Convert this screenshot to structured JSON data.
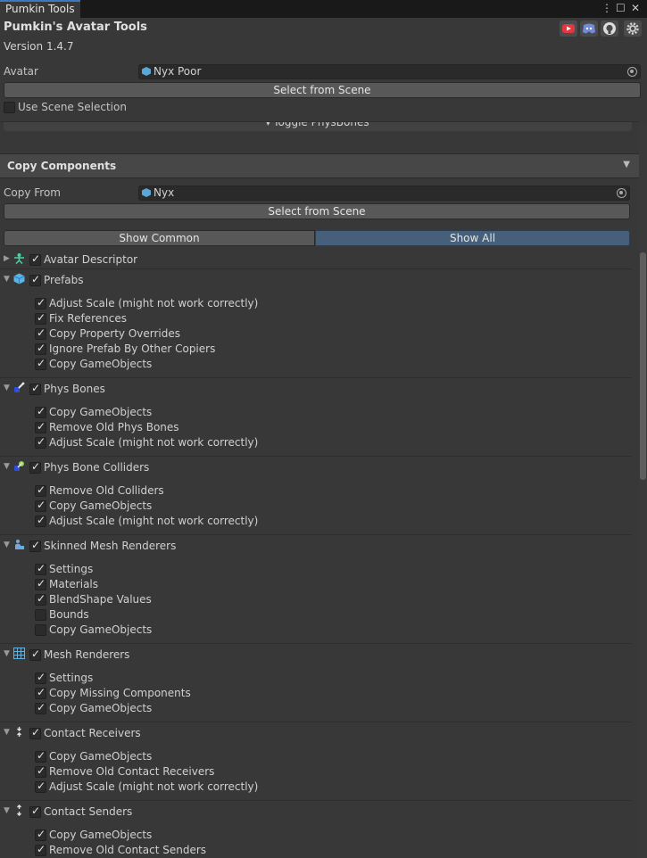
{
  "window": {
    "tab_title": "Pumkin Tools",
    "menu_glyph": "⋮",
    "maximize_glyph": "☐",
    "close_glyph": "✕"
  },
  "header": {
    "title": "Pumkin's Avatar Tools",
    "version": "Version 1.4.7",
    "icons": [
      "youtube-icon",
      "discord-icon",
      "github-icon",
      "settings-icon"
    ]
  },
  "avatar": {
    "label": "Avatar",
    "value": "Nyx Poor",
    "select_button": "Select from Scene",
    "use_scene_selection": {
      "label": "Use Scene Selection",
      "checked": false
    }
  },
  "clipped_toolbar": {
    "label": "Toggle PhysBones"
  },
  "copy_components": {
    "title": "Copy Components",
    "copy_from_label": "Copy From",
    "copy_from_value": "Nyx",
    "select_button": "Select from Scene",
    "filter": {
      "show_common": "Show Common",
      "show_all": "Show All",
      "active": "show_all"
    },
    "components": [
      {
        "name": "Avatar Descriptor",
        "checked": true,
        "expanded": false,
        "icon": "avatar-descriptor-icon",
        "options": []
      },
      {
        "name": "Prefabs",
        "checked": true,
        "expanded": true,
        "icon": "prefab-cube-icon",
        "options": [
          {
            "label": "Adjust Scale (might not work correctly)",
            "checked": true
          },
          {
            "label": "Fix References",
            "checked": true
          },
          {
            "label": "Copy Property Overrides",
            "checked": true
          },
          {
            "label": "Ignore Prefab By Other Copiers",
            "checked": true
          },
          {
            "label": "Copy GameObjects",
            "checked": true
          }
        ]
      },
      {
        "name": "Phys Bones",
        "checked": true,
        "expanded": true,
        "icon": "physbone-icon",
        "options": [
          {
            "label": "Copy GameObjects",
            "checked": true
          },
          {
            "label": "Remove Old Phys Bones",
            "checked": true
          },
          {
            "label": "Adjust Scale (might not work correctly)",
            "checked": true
          }
        ]
      },
      {
        "name": "Phys Bone Colliders",
        "checked": true,
        "expanded": true,
        "icon": "physbone-collider-icon",
        "options": [
          {
            "label": "Remove Old Colliders",
            "checked": true
          },
          {
            "label": "Copy GameObjects",
            "checked": true
          },
          {
            "label": "Adjust Scale (might not work correctly)",
            "checked": true
          }
        ]
      },
      {
        "name": "Skinned Mesh Renderers",
        "checked": true,
        "expanded": true,
        "icon": "skinned-mesh-renderer-icon",
        "options": [
          {
            "label": "Settings",
            "checked": true
          },
          {
            "label": "Materials",
            "checked": true
          },
          {
            "label": "BlendShape Values",
            "checked": true
          },
          {
            "label": "Bounds",
            "checked": false
          },
          {
            "label": "Copy GameObjects",
            "checked": false
          }
        ]
      },
      {
        "name": "Mesh Renderers",
        "checked": true,
        "expanded": true,
        "icon": "mesh-renderer-icon",
        "options": [
          {
            "label": "Settings",
            "checked": true
          },
          {
            "label": "Copy Missing Components",
            "checked": true
          },
          {
            "label": "Copy GameObjects",
            "checked": true
          }
        ]
      },
      {
        "name": "Contact Receivers",
        "checked": true,
        "expanded": true,
        "icon": "contact-receiver-icon",
        "options": [
          {
            "label": "Copy GameObjects",
            "checked": true
          },
          {
            "label": "Remove Old Contact Receivers",
            "checked": true
          },
          {
            "label": "Adjust Scale (might not work correctly)",
            "checked": true
          }
        ]
      },
      {
        "name": "Contact Senders",
        "checked": true,
        "expanded": true,
        "icon": "contact-sender-icon",
        "options": [
          {
            "label": "Copy GameObjects",
            "checked": true
          },
          {
            "label": "Remove Old Contact Senders",
            "checked": true
          }
        ]
      }
    ]
  },
  "colors": {
    "accent": "#3a79bb",
    "active_button": "#46607c",
    "background": "#383838"
  }
}
